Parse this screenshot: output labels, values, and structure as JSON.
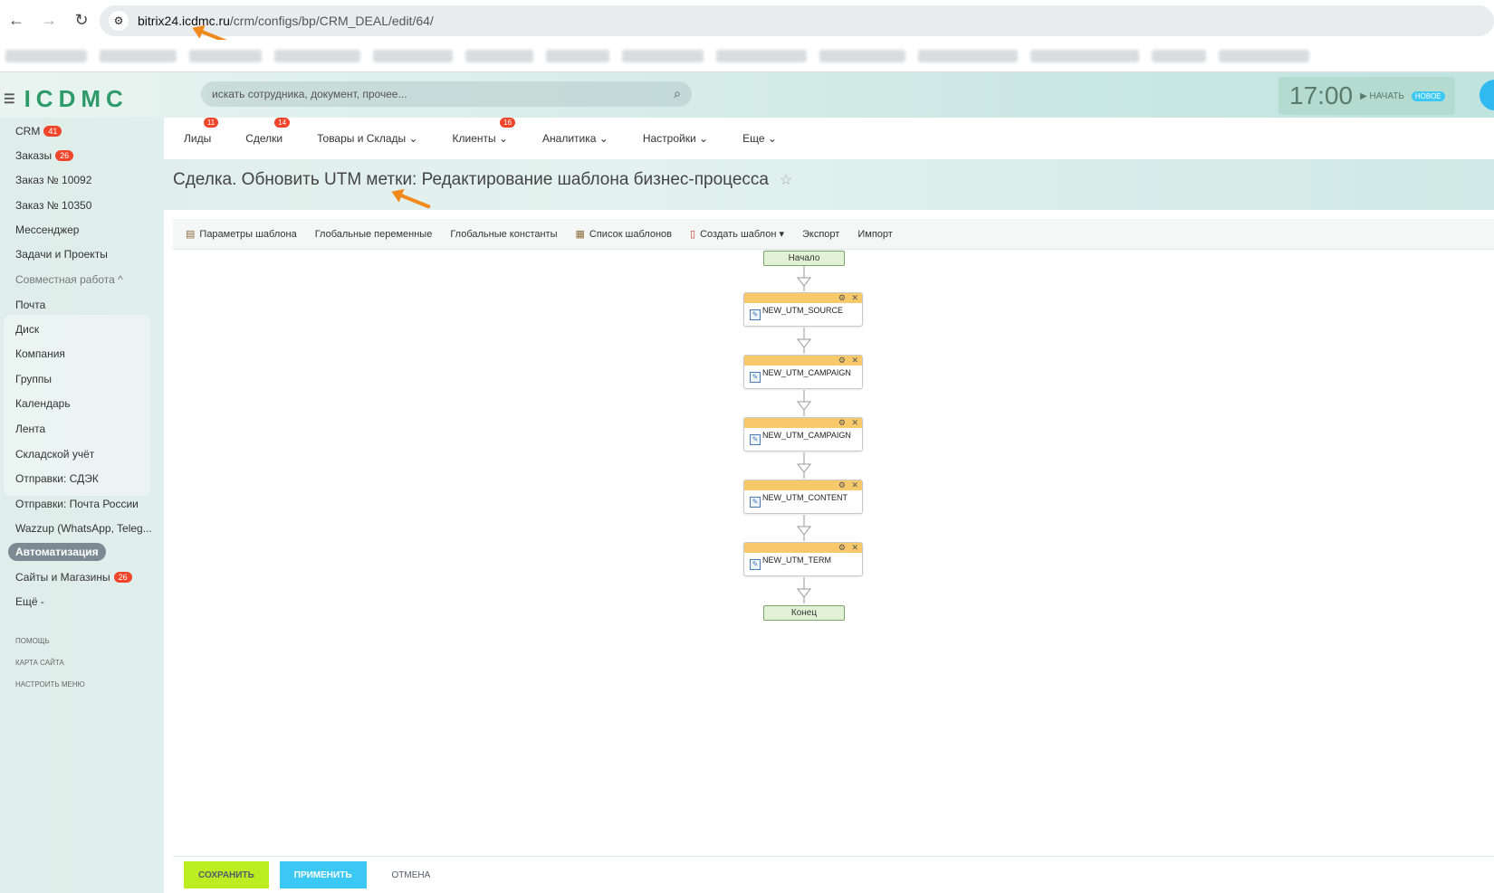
{
  "browser": {
    "url_host": "bitrix24.icdmc.ru",
    "url_path": "/crm/configs/bp/CRM_DEAL/edit/64/"
  },
  "header": {
    "logo": "ICDMC",
    "search_placeholder": "искать сотрудника, документ, прочее...",
    "time": "17:00",
    "start_label": "НАЧАТЬ",
    "new_badge": "НОВОЕ"
  },
  "sidebar": {
    "items": [
      {
        "label": "CRM",
        "count": "41"
      },
      {
        "label": "Заказы",
        "count": "26"
      },
      {
        "label": "Заказ № 10092"
      },
      {
        "label": "Заказ № 10350"
      },
      {
        "label": "Мессенджер"
      },
      {
        "label": "Задачи и Проекты"
      },
      {
        "label": "Совместная работа ^"
      },
      {
        "label": "Почта"
      },
      {
        "label": "Диск"
      },
      {
        "label": "Компания"
      },
      {
        "label": "Группы"
      },
      {
        "label": "Календарь"
      },
      {
        "label": "Лента"
      },
      {
        "label": "Складской учёт"
      },
      {
        "label": "Отправки: СДЭК"
      },
      {
        "label": "Отправки: Почта России"
      },
      {
        "label": "Wazzup (WhatsApp, Teleg..."
      },
      {
        "label": "Автоматизация"
      },
      {
        "label": "Сайты и Магазины",
        "count": "26"
      },
      {
        "label": "Ещё -"
      }
    ],
    "footer_links": [
      "ПОМОЩЬ",
      "КАРТА САЙТА",
      "НАСТРОИТЬ МЕНЮ"
    ]
  },
  "menu": {
    "items": [
      {
        "label": "Лиды",
        "badge": "11"
      },
      {
        "label": "Сделки",
        "badge": "14"
      },
      {
        "label": "Товары и Склады ⌄"
      },
      {
        "label": "Клиенты ⌄",
        "badge": "16"
      },
      {
        "label": "Аналитика ⌄"
      },
      {
        "label": "Настройки ⌄"
      },
      {
        "label": "Еще ⌄"
      }
    ]
  },
  "page": {
    "title": "Сделка. Обновить UTM метки: Редактирование шаблона бизнес-процесса"
  },
  "toolbar": {
    "items": [
      "Параметры шаблона",
      "Глобальные переменные",
      "Глобальные константы",
      "Список шаблонов",
      "Создать шаблон ▾",
      "Экспорт",
      "Импорт"
    ]
  },
  "diagram": {
    "start": "Начало",
    "end": "Конец",
    "activities": [
      "NEW_UTM_SOURCE",
      "NEW_UTM_CAMPAIGN",
      "NEW_UTM_CAMPAIGN",
      "NEW_UTM_CONTENT",
      "NEW_UTM_TERM"
    ]
  },
  "footer": {
    "save": "СОХРАНИТЬ",
    "apply": "ПРИМЕНИТЬ",
    "cancel": "ОТМЕНА"
  },
  "colors": {
    "accent_green": "#bbed21",
    "accent_blue": "#3bc8f5",
    "badge_red": "#f0452b",
    "activity_header": "#f7c96a",
    "annotation_arrow": "#f08a1c"
  }
}
